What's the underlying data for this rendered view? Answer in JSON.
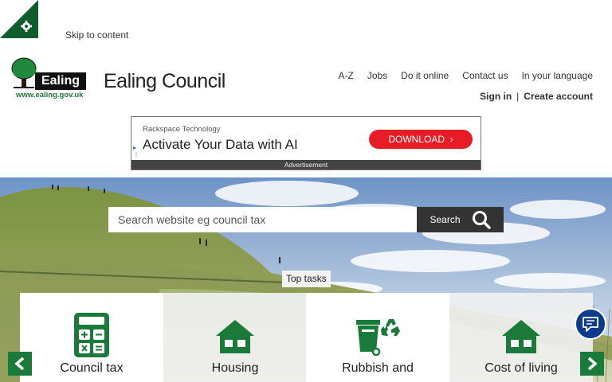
{
  "header": {
    "skip_link": "Skip to content",
    "logo_text": "Ealing",
    "logo_url": "www.ealing.gov.uk",
    "site_title": "Ealing Council"
  },
  "topnav": [
    {
      "label": "A-Z"
    },
    {
      "label": "Jobs"
    },
    {
      "label": "Do it online"
    },
    {
      "label": "Contact us"
    },
    {
      "label": "In your language"
    }
  ],
  "account": {
    "sign_in": "Sign in",
    "separator": "|",
    "create": "Create account"
  },
  "ad": {
    "brand": "Rackspace Technology",
    "headline": "Activate Your Data with AI",
    "button": "DOWNLOAD",
    "footer": "Advertisement"
  },
  "search": {
    "placeholder": "Search website eg council tax",
    "button": "Search"
  },
  "top_tasks_label": "Top tasks",
  "tiles": [
    {
      "label": "Council tax",
      "icon": "calculator-icon"
    },
    {
      "label": "Housing",
      "icon": "house-icon"
    },
    {
      "label": "Rubbish and",
      "icon": "recycling-bin-icon"
    },
    {
      "label": "Cost of living",
      "icon": "house-icon"
    }
  ],
  "colors": {
    "brand_green": "#1a7a3a",
    "search_button": "#333333",
    "ad_button": "#e81c24",
    "chat_button": "#0d3c8c"
  }
}
